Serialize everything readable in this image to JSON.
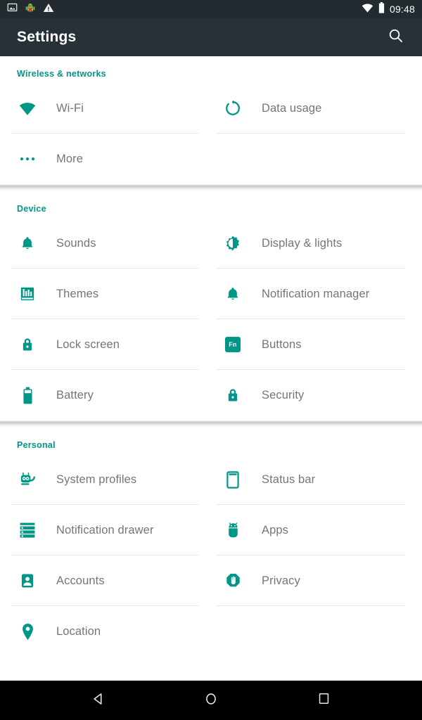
{
  "colors": {
    "accent": "#009688",
    "action_bar": "#263238",
    "status_bar": "#212b30",
    "label": "#757575",
    "nav_bar": "#000000",
    "divider": "#e4e4e4"
  },
  "status_bar": {
    "left_icons": [
      "image-icon",
      "android-bug-icon",
      "warning-triangle-icon"
    ],
    "right_icons": [
      "wifi-icon",
      "battery-icon"
    ],
    "clock": "09:48"
  },
  "action_bar": {
    "title": "Settings",
    "search_label": "search-icon"
  },
  "sections": [
    {
      "header": "Wireless & networks",
      "tiles": [
        {
          "label": "Wi-Fi",
          "icon": "wifi-icon",
          "divided": true
        },
        {
          "label": "Data usage",
          "icon": "data-usage-icon",
          "divided": true
        },
        {
          "label": "More",
          "icon": "more-dots-icon",
          "divided": false
        },
        {
          "label": "",
          "icon": "",
          "divided": false,
          "empty": true
        }
      ]
    },
    {
      "header": "Device",
      "tiles": [
        {
          "label": "Sounds",
          "icon": "bell-icon",
          "divided": true
        },
        {
          "label": "Display & lights",
          "icon": "brightness-icon",
          "divided": true
        },
        {
          "label": "Themes",
          "icon": "themes-icon",
          "divided": true
        },
        {
          "label": "Notification manager",
          "icon": "bell-icon",
          "divided": true
        },
        {
          "label": "Lock screen",
          "icon": "lock-icon",
          "divided": true
        },
        {
          "label": "Buttons",
          "icon": "fn-key-icon",
          "divided": true
        },
        {
          "label": "Battery",
          "icon": "battery-icon",
          "divided": false
        },
        {
          "label": "Security",
          "icon": "lock-icon",
          "divided": false
        }
      ]
    },
    {
      "header": "Personal",
      "tiles": [
        {
          "label": "System profiles",
          "icon": "cid-robot-icon",
          "divided": true
        },
        {
          "label": "Status bar",
          "icon": "phone-outline-icon",
          "divided": true
        },
        {
          "label": "Notification drawer",
          "icon": "notification-list-icon",
          "divided": true
        },
        {
          "label": "Apps",
          "icon": "android-head-icon",
          "divided": true
        },
        {
          "label": "Accounts",
          "icon": "person-badge-icon",
          "divided": true
        },
        {
          "label": "Privacy",
          "icon": "privacy-hand-icon",
          "divided": true
        },
        {
          "label": "Location",
          "icon": "map-pin-icon",
          "divided": false
        },
        {
          "label": "",
          "icon": "",
          "divided": false,
          "empty": true
        }
      ]
    }
  ],
  "nav_bar": {
    "buttons": [
      {
        "name": "back-button",
        "icon": "back-triangle-icon"
      },
      {
        "name": "home-button",
        "icon": "home-circle-icon"
      },
      {
        "name": "recents-button",
        "icon": "recents-square-icon"
      }
    ]
  }
}
